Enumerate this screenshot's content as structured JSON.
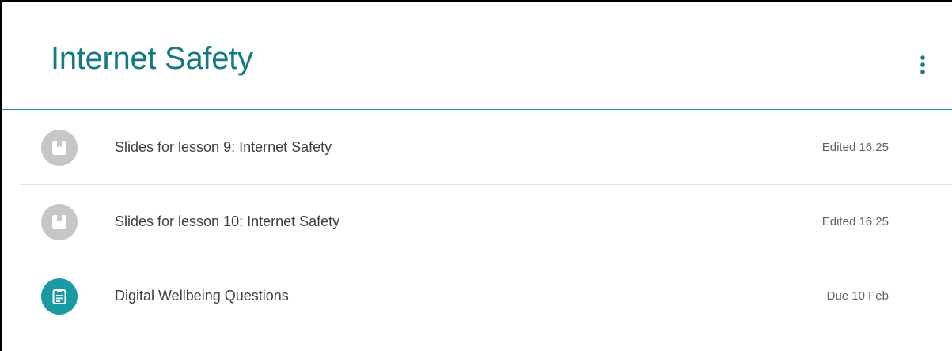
{
  "topic": {
    "title": "Internet Safety",
    "accent_color": "#137a84",
    "divider_color": "#1e8e9a",
    "menu_icon": "more-vert-icon"
  },
  "items": [
    {
      "title": "Slides for lesson 9: Internet Safety",
      "meta": "Edited 16:25",
      "icon": "material-icon",
      "icon_color": "#c6c6c6"
    },
    {
      "title": "Slides for lesson 10: Internet Safety",
      "meta": "Edited 16:25",
      "icon": "material-icon",
      "icon_color": "#c6c6c6"
    },
    {
      "title": "Digital Wellbeing Questions",
      "meta": "Due 10 Feb",
      "icon": "assignment-icon",
      "icon_color": "#1a9ba4"
    }
  ]
}
